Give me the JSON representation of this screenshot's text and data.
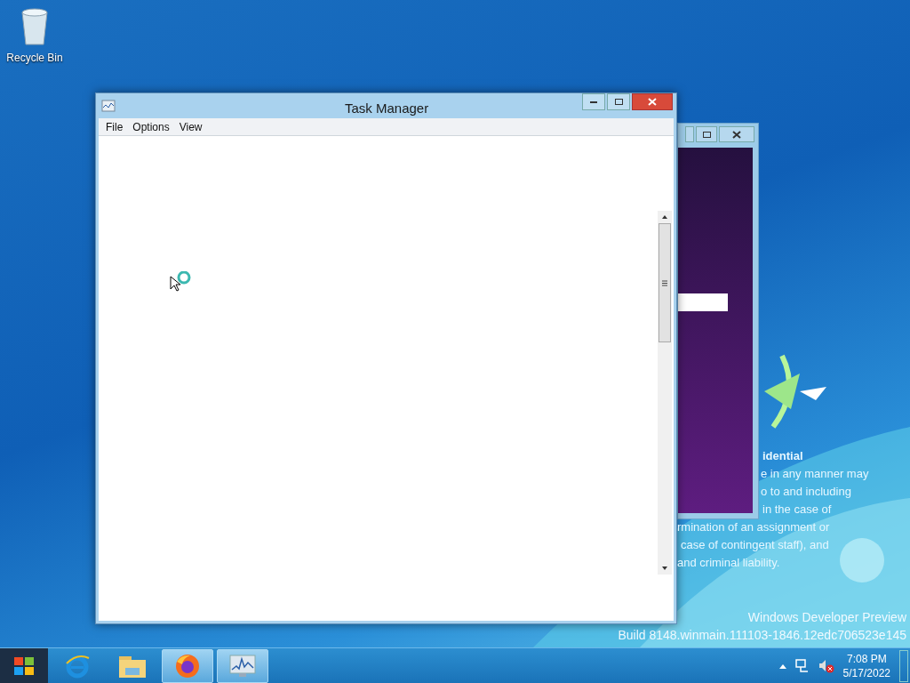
{
  "desktop_icons": [
    {
      "label": "Recycle Bin"
    }
  ],
  "window": {
    "title": "Task Manager",
    "menu": [
      "File",
      "Options",
      "View"
    ]
  },
  "desktop_notice": {
    "heading": "idential",
    "lines": [
      "e in any manner may",
      "o to and including",
      "in the case of",
      "rmination of an assignment or",
      "case of contingent staff), and",
      "and criminal liability."
    ]
  },
  "build_info": [
    "Windows Developer Preview",
    "Build 8148.winmain.111103-1846.12edc706523e145"
  ],
  "taskbar": {
    "apps": [
      {
        "kind": "browser-e",
        "running": false
      },
      {
        "kind": "folder",
        "running": false
      },
      {
        "kind": "firefox",
        "running": true
      },
      {
        "kind": "monitor",
        "running": true
      }
    ],
    "clock": {
      "time": "7:08 PM",
      "date": "5/17/2022"
    }
  }
}
